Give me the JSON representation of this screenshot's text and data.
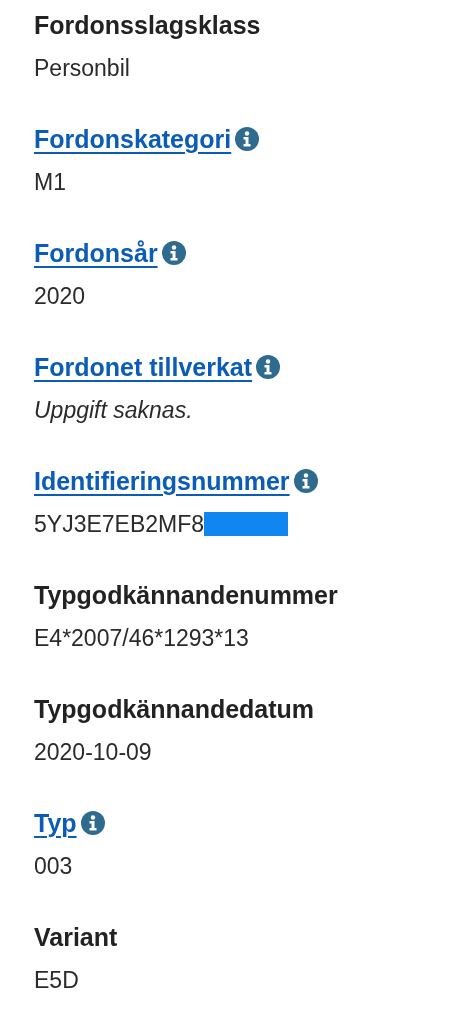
{
  "fields": [
    {
      "label": "Fordonsslagsklass",
      "kind": "plain",
      "info": false,
      "value": "Personbil",
      "italic": false,
      "redacted": false
    },
    {
      "label": "Fordonskategori",
      "kind": "link",
      "info": true,
      "value": "M1",
      "italic": false,
      "redacted": false
    },
    {
      "label": "Fordonsår",
      "kind": "link",
      "info": true,
      "value": "2020",
      "italic": false,
      "redacted": false
    },
    {
      "label": "Fordonet tillverkat",
      "kind": "link",
      "info": true,
      "value": "Uppgift saknas.",
      "italic": true,
      "redacted": false
    },
    {
      "label": "Identifieringsnummer",
      "kind": "link",
      "info": true,
      "value": "5YJ3E7EB2MF8",
      "italic": false,
      "redacted": true
    },
    {
      "label": "Typgodkännandenummer",
      "kind": "plain",
      "info": false,
      "value": "E4*2007/46*1293*13",
      "italic": false,
      "redacted": false
    },
    {
      "label": "Typgodkännandedatum",
      "kind": "plain",
      "info": false,
      "value": "2020-10-09",
      "italic": false,
      "redacted": false
    },
    {
      "label": "Typ",
      "kind": "link",
      "info": true,
      "value": "003",
      "italic": false,
      "redacted": false
    },
    {
      "label": "Variant",
      "kind": "plain",
      "info": false,
      "value": "E5D",
      "italic": false,
      "redacted": false
    }
  ]
}
